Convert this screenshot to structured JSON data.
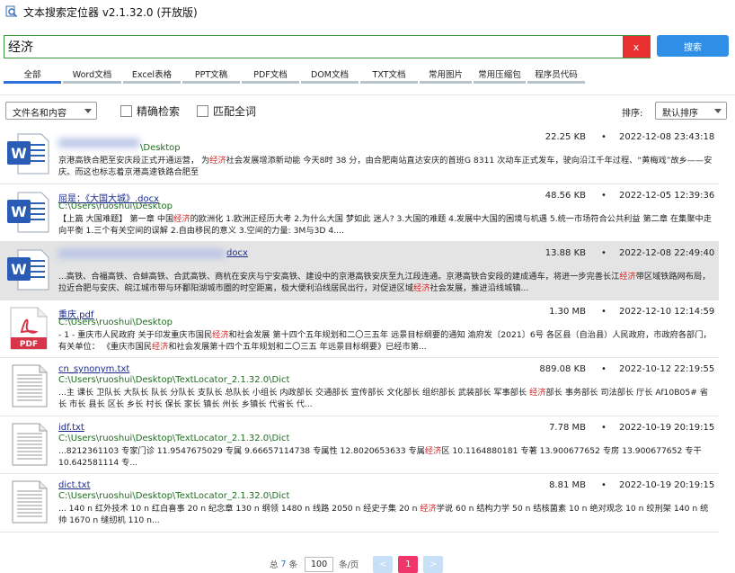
{
  "app": {
    "title": "文本搜索定位器 v2.1.32.0 (开放版)"
  },
  "search": {
    "query": "经济",
    "clear_label": "x",
    "button_label": "搜索"
  },
  "tabs": [
    {
      "label": "全部",
      "active": true
    },
    {
      "label": "Word文档"
    },
    {
      "label": "Excel表格"
    },
    {
      "label": "PPT文稿"
    },
    {
      "label": "PDF文档"
    },
    {
      "label": "DOM文档"
    },
    {
      "label": "TXT文档"
    },
    {
      "label": "常用图片"
    },
    {
      "label": "常用压缩包"
    },
    {
      "label": "程序员代码"
    }
  ],
  "filters": {
    "scope_select": "文件名和内容",
    "exact_search_label": "精确检索",
    "whole_word_label": "匹配全词",
    "sort_label": "排序:",
    "sort_select": "默认排序"
  },
  "results": [
    {
      "icon": "word-doc-icon",
      "name": "",
      "path": "\\Desktop",
      "size": "22.25 KB",
      "dot": "•",
      "date": "2022-12-08 23:43:18",
      "snippet": [
        {
          "t": "京港高铁合肥至安庆段正式开通运营，   为"
        },
        {
          "t": "经济",
          "h": true
        },
        {
          "t": "社会发展增添新动能"
        },
        {
          "t": "\n今天8时   38   分，由合肥南站直达安庆的首班G   8311   次动车正式发车，驶向沿江千年过程、“黄梅戏”故乡——安庆。而这也标志着京港高速铁路合肥至"
        }
      ]
    },
    {
      "icon": "word-doc-icon",
      "name": "屈是：《大国大城》.docx",
      "path": "C:\\Users\\ruoshui\\Desktop",
      "size": "48.56 KB",
      "dot": "•",
      "date": "2022-12-05 12:39:36",
      "snippet": [
        {
          "t": "【上篇 大国难题】 第一章 中国"
        },
        {
          "t": "经济",
          "h": true
        },
        {
          "t": "的欧洲化 1.欧洲正经历大考 2.为什么大国   梦如此   迷人? 3.大国的难题 4.发展中大国的困境与机遇 5.统一市场符合公共利益 第二章 在集聚中走向平衡 1.三个有关空间的误解 2.自由移民的意义 3.空间的力量: 3M与3D 4...."
        }
      ]
    },
    {
      "icon": "word-doc-icon",
      "name": "docx",
      "path": "",
      "size": "13.88 KB",
      "dot": "•",
      "date": "2022-12-08 22:49:40",
      "highlight": true,
      "snippet": [
        {
          "t": "...高铁、合福高铁、合蚌高铁、合武高铁、商杭在安庆与宁安高铁、建设中的京港高铁安庆至九江段连通。京港高铁合安段的建成通车，将进一步完善长江"
        },
        {
          "t": "经济",
          "h": true
        },
        {
          "t": "带区域铁路网布局，拉近合肥与安庆、皖江城市带与环鄱阳湖城市圈的时空距离，极大便利沿线居民出行，对促进区域"
        },
        {
          "t": "经济",
          "h": true
        },
        {
          "t": "社会发展，推进沿线城镇..."
        }
      ]
    },
    {
      "icon": "pdf-icon",
      "name": "重庆.pdf",
      "path": "C:\\Users\\ruoshui\\Desktop",
      "size": "1.30 MB",
      "dot": "•",
      "date": "2022-12-10 12:14:59",
      "snippet": [
        {
          "t": "- 1 - 重庆市人民政府 关于印发重庆市国民"
        },
        {
          "t": "经济",
          "h": true
        },
        {
          "t": "和社会发展 第十四个五年规划和二〇三五年 远景目标纲要的通知 渝府发〔2021〕6号   各区县（自治县）人民政府，市政府各部门，有关单位：   《重庆市国民"
        },
        {
          "t": "经济",
          "h": true
        },
        {
          "t": "和社会发展第十四个五年规划和二〇三五   年远景目标纲要》已经市第..."
        }
      ]
    },
    {
      "icon": "txt-file-icon",
      "name": "cn_synonym.txt",
      "path": "C:\\Users\\ruoshui\\Desktop\\TextLocator_2.1.32.0\\Dict",
      "size": "889.08 KB",
      "dot": "•",
      "date": "2022-10-12 22:19:55",
      "snippet": [
        {
          "t": "...主 课长 卫队长 大队长 队长 分队长 支队长 总队长 小组长 内政部长 交通部长 宣传部长 文化部长 组织部长 武装部长 军事部长 "
        },
        {
          "t": "经济",
          "h": true
        },
        {
          "t": "部长 事务部长 司法部长 厅长   Af10B05# 省长 市长 县长 区长 乡长 村长 保长 家长 镇长 州长 乡镇长 代省长 代..."
        }
      ]
    },
    {
      "icon": "txt-file-icon",
      "name": "idf.txt",
      "path": "C:\\Users\\ruoshui\\Desktop\\TextLocator_2.1.32.0\\Dict",
      "size": "7.78 MB",
      "dot": "•",
      "date": "2022-10-19 20:19:15",
      "snippet": [
        {
          "t": "...8212361103     专家门诊 11.9547675029     专属 9.66657114738     专属性 12.8020653633     专属"
        },
        {
          "t": "经济",
          "h": true
        },
        {
          "t": "区 10.1164880181     专著 13.900677652     专房 13.900677652     专干 10.642581114     专..."
        }
      ]
    },
    {
      "icon": "txt-file-icon",
      "name": "dict.txt",
      "path": "C:\\Users\\ruoshui\\Desktop\\TextLocator_2.1.32.0\\Dict",
      "size": "8.81 MB",
      "dot": "•",
      "date": "2022-10-19 20:19:15",
      "snippet": [
        {
          "t": "... 140 n   红外技术 10 n   红白喜事 20 n   纪念章 130 n   纲领 1480 n   线路 2050 n   经史子集 20 n   "
        },
        {
          "t": "经济",
          "h": true
        },
        {
          "t": "学说 60 n   结构力学 50 n   结核菌素 10 n   绝对观念 10 n   绞刑架 140 n   统帅 1670 n   缝纫机 110 n..."
        }
      ]
    }
  ],
  "pager": {
    "total_prefix": "总",
    "total": "7",
    "total_suffix": "条",
    "per_page": "100",
    "per_page_suffix": "条/页",
    "prev": "<",
    "current": "1",
    "next": ">"
  }
}
